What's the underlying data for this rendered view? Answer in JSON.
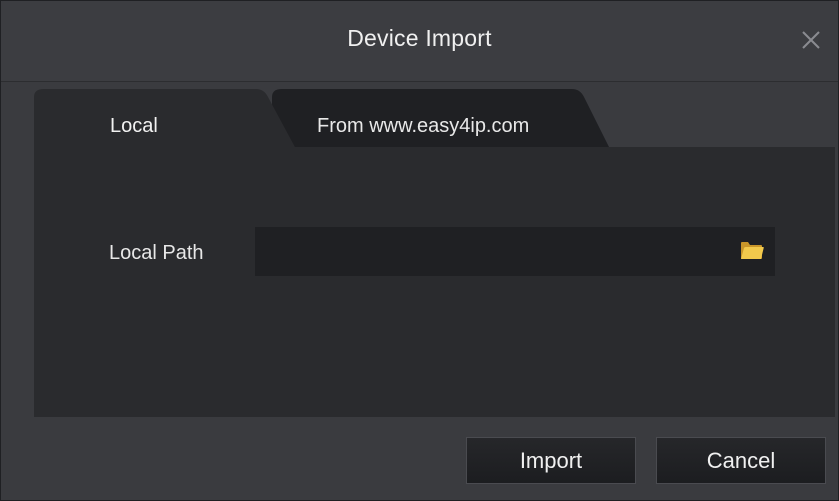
{
  "dialog": {
    "title": "Device Import",
    "close_icon": "close-icon"
  },
  "tabs": [
    {
      "label": "Local",
      "active": true
    },
    {
      "label": "From www.easy4ip.com",
      "active": false
    }
  ],
  "local": {
    "path_label": "Local Path",
    "path_value": "",
    "browse_icon": "folder-icon"
  },
  "buttons": {
    "import_label": "Import",
    "cancel_label": "Cancel"
  },
  "colors": {
    "background": "#3a3b3f",
    "panel": "#2a2b2e",
    "input": "#1f2023",
    "folder": "#f2c94c"
  }
}
